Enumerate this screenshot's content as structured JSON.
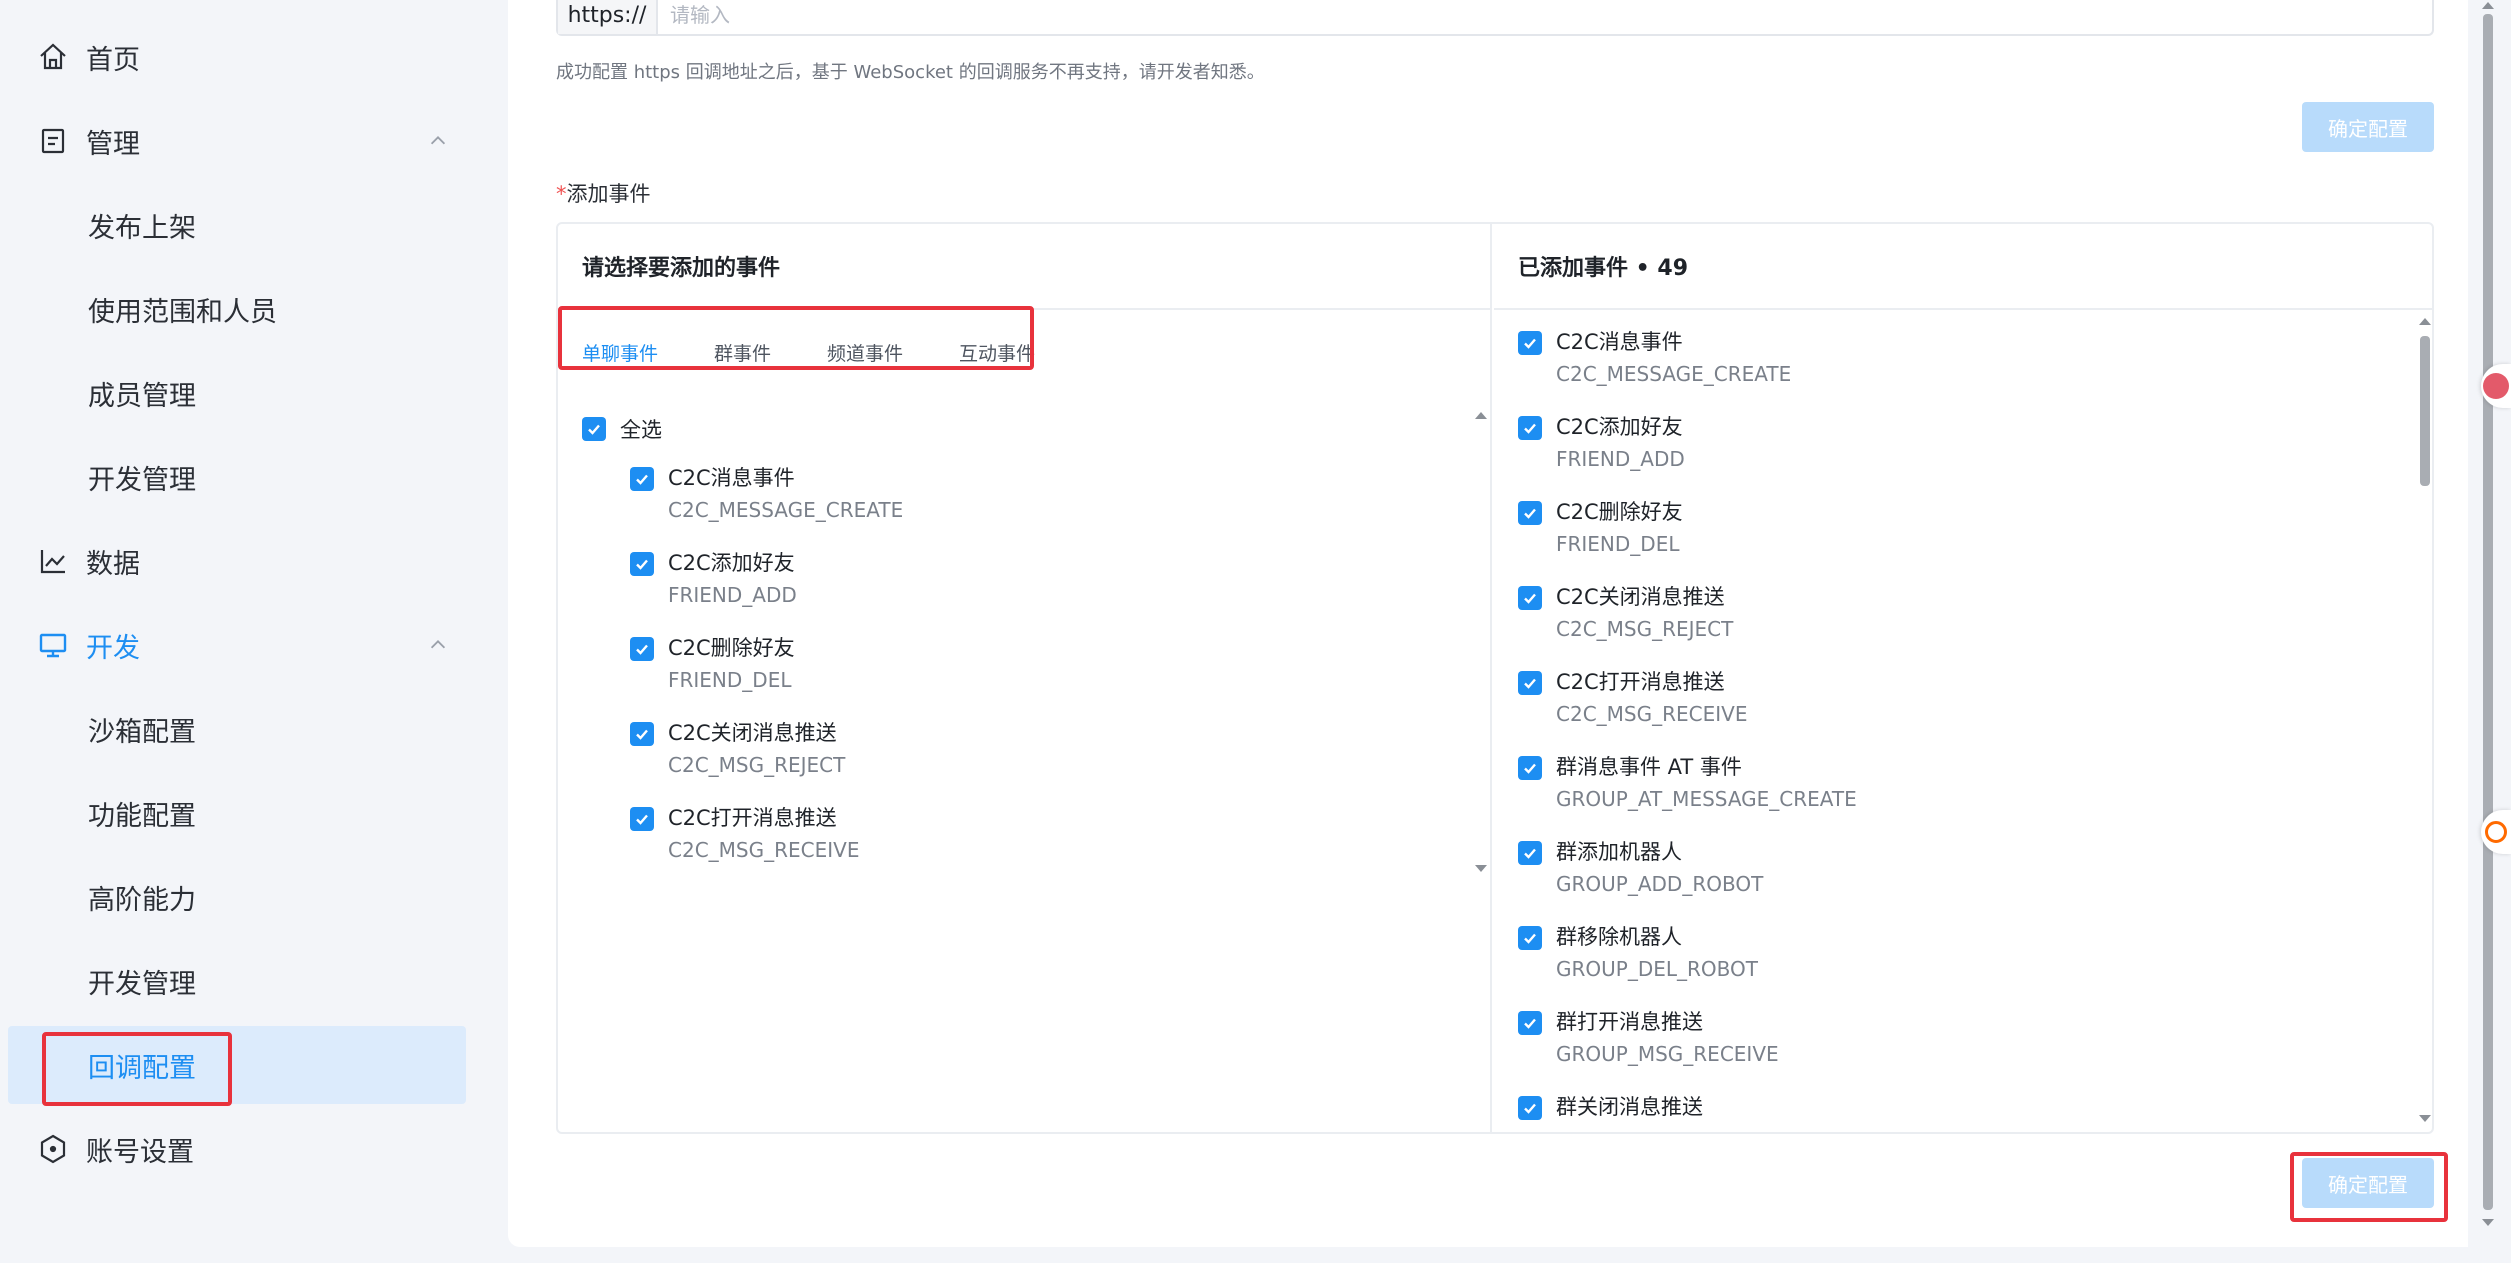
{
  "sidebar": {
    "items": [
      {
        "label": "首页",
        "icon": "home-icon"
      },
      {
        "label": "管理",
        "icon": "document-icon"
      },
      {
        "label": "发布上架"
      },
      {
        "label": "使用范围和人员"
      },
      {
        "label": "成员管理"
      },
      {
        "label": "开发管理"
      },
      {
        "label": "数据",
        "icon": "line-chart-icon"
      },
      {
        "label": "开发",
        "icon": "monitor-icon"
      },
      {
        "label": "沙箱配置"
      },
      {
        "label": "功能配置"
      },
      {
        "label": "高阶能力"
      },
      {
        "label": "开发管理"
      },
      {
        "label": "回调配置"
      },
      {
        "label": "账号设置",
        "icon": "hexagon-icon"
      }
    ],
    "active_item": "回调配置"
  },
  "callback": {
    "url_prefix": "https://",
    "url_placeholder": "请输入",
    "url_value": "",
    "hint": "成功配置 https 回调地址之后，基于 WebSocket 的回调服务不再支持，请开发者知悉。",
    "confirm_label": "确定配置"
  },
  "events": {
    "section_required_mark": "*",
    "section_label": "添加事件",
    "left_title": "请选择要添加的事件",
    "tabs": [
      "单聊事件",
      "群事件",
      "频道事件",
      "互动事件"
    ],
    "active_tab": "单聊事件",
    "select_all_label": "全选",
    "available": [
      {
        "name": "C2C消息事件",
        "code": "C2C_MESSAGE_CREATE",
        "checked": true
      },
      {
        "name": "C2C添加好友",
        "code": "FRIEND_ADD",
        "checked": true
      },
      {
        "name": "C2C删除好友",
        "code": "FRIEND_DEL",
        "checked": true
      },
      {
        "name": "C2C关闭消息推送",
        "code": "C2C_MSG_REJECT",
        "checked": true
      },
      {
        "name": "C2C打开消息推送",
        "code": "C2C_MSG_RECEIVE",
        "checked": true
      }
    ],
    "right_title": "已添加事件 • 49",
    "added": [
      {
        "name": "C2C消息事件",
        "code": "C2C_MESSAGE_CREATE"
      },
      {
        "name": "C2C添加好友",
        "code": "FRIEND_ADD"
      },
      {
        "name": "C2C删除好友",
        "code": "FRIEND_DEL"
      },
      {
        "name": "C2C关闭消息推送",
        "code": "C2C_MSG_REJECT"
      },
      {
        "name": "C2C打开消息推送",
        "code": "C2C_MSG_RECEIVE"
      },
      {
        "name": "群消息事件 AT 事件",
        "code": "GROUP_AT_MESSAGE_CREATE"
      },
      {
        "name": "群添加机器人",
        "code": "GROUP_ADD_ROBOT"
      },
      {
        "name": "群移除机器人",
        "code": "GROUP_DEL_ROBOT"
      },
      {
        "name": "群打开消息推送",
        "code": "GROUP_MSG_RECEIVE"
      },
      {
        "name": "群关闭消息推送",
        "code": ""
      }
    ],
    "confirm_label": "确定配置"
  },
  "colors": {
    "accent": "#1d8ef2",
    "highlight_box": "#e8323c",
    "disabled_button": "#b8dbfb"
  }
}
